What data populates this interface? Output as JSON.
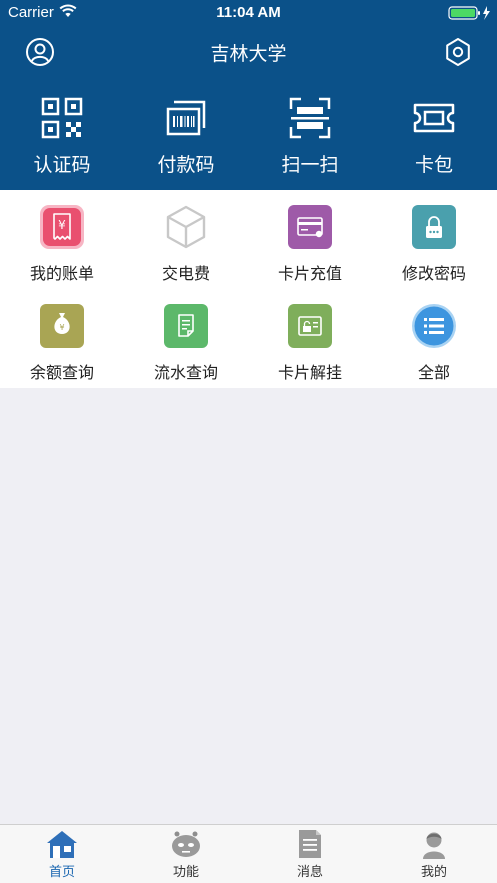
{
  "status_bar": {
    "carrier": "Carrier",
    "time": "11:04 AM"
  },
  "header": {
    "title": "吉林大学"
  },
  "quick_actions": [
    {
      "label": "认证码",
      "icon": "qr-code-icon"
    },
    {
      "label": "付款码",
      "icon": "barcode-card-icon"
    },
    {
      "label": "扫一扫",
      "icon": "scan-icon"
    },
    {
      "label": "卡包",
      "icon": "ticket-icon"
    }
  ],
  "functions": [
    {
      "label": "我的账单",
      "icon": "bill-icon",
      "color": "#e9506f"
    },
    {
      "label": "交电费",
      "icon": "cube-icon",
      "color": "#c8c8c8"
    },
    {
      "label": "卡片充值",
      "icon": "card-recharge-icon",
      "color": "#9e5aa8"
    },
    {
      "label": "修改密码",
      "icon": "lock-icon",
      "color": "#4aa0ad"
    },
    {
      "label": "余额查询",
      "icon": "money-bag-icon",
      "color": "#a9a554"
    },
    {
      "label": "流水查询",
      "icon": "document-icon",
      "color": "#5cb86a"
    },
    {
      "label": "卡片解挂",
      "icon": "card-unlock-icon",
      "color": "#7fae5b"
    },
    {
      "label": "全部",
      "icon": "list-icon",
      "color": "#3d95df"
    }
  ],
  "tabs": [
    {
      "label": "首页",
      "icon": "home-icon",
      "active": true
    },
    {
      "label": "功能",
      "icon": "robot-icon",
      "active": false
    },
    {
      "label": "消息",
      "icon": "message-icon",
      "active": false
    },
    {
      "label": "我的",
      "icon": "profile-icon",
      "active": false
    }
  ],
  "colors": {
    "primary": "#0b5189",
    "background": "#efeff4",
    "tab_active": "#1a66b0",
    "tab_inactive": "#8e8e8e"
  }
}
